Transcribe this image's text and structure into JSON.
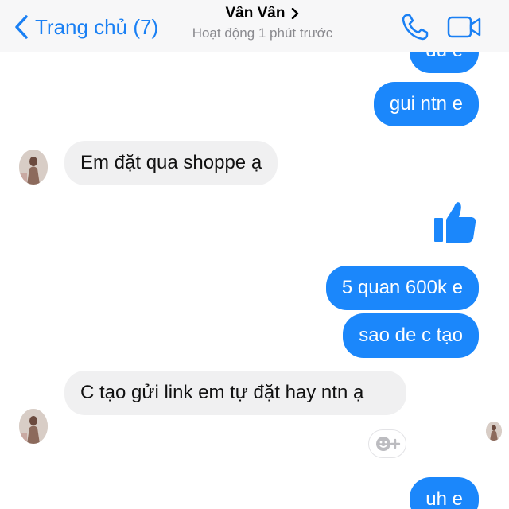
{
  "header": {
    "back_label": "Trang chủ (7)",
    "contact_name": "Vân Vân",
    "status": "Hoạt động 1 phút trước",
    "icons": {
      "back": "chevron-left-icon",
      "name": "chevron-right-icon",
      "call": "phone-icon",
      "video": "video-camera-icon"
    }
  },
  "colors": {
    "accent": "#1a80f4",
    "outgoing_bubble": "#1b87fb",
    "incoming_bubble": "#f0f0f1",
    "header_bg": "#f7f7f8"
  },
  "messages": [
    {
      "direction": "outgoing",
      "text": "du e"
    },
    {
      "direction": "outgoing",
      "text": "gui ntn e"
    },
    {
      "direction": "incoming",
      "text": "Em đặt qua shoppe ạ"
    },
    {
      "direction": "outgoing",
      "type": "sticker",
      "icon": "thumbs-up-icon"
    },
    {
      "direction": "outgoing",
      "text": "5 quan 600k e"
    },
    {
      "direction": "outgoing",
      "text": "sao de c tạo"
    },
    {
      "direction": "incoming",
      "text": "C tạo gửi link em tự đặt hay ntn ạ"
    },
    {
      "direction": "outgoing",
      "text": "uh e"
    }
  ],
  "reaction_button_icon": "add-reaction-icon"
}
